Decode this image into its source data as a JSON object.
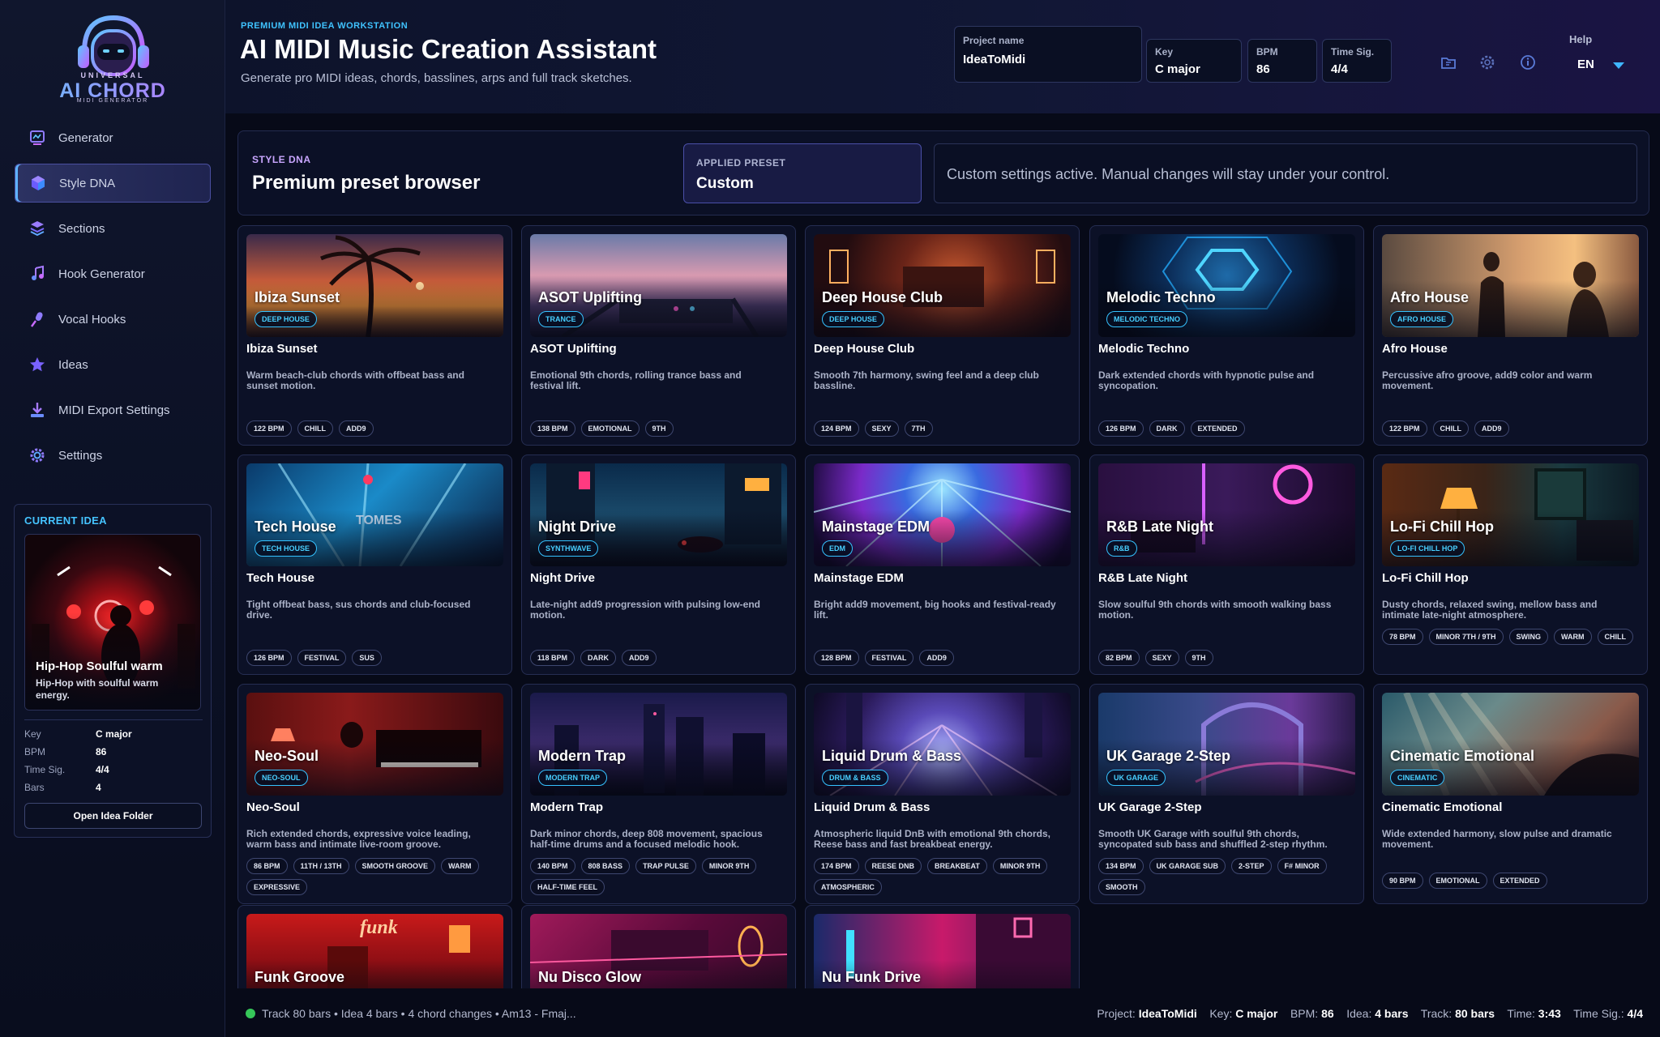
{
  "brand": {
    "line1": "UNIVERSAL",
    "line2": "AI CHORD",
    "line3": "MIDI GENERATOR"
  },
  "sidebar": {
    "items": [
      {
        "label": "Generator",
        "icon": "generator-icon",
        "active": false
      },
      {
        "label": "Style DNA",
        "icon": "style-dna-icon",
        "active": true
      },
      {
        "label": "Sections",
        "icon": "sections-icon",
        "active": false
      },
      {
        "label": "Hook Generator",
        "icon": "music-note-icon",
        "active": false
      },
      {
        "label": "Vocal Hooks",
        "icon": "microphone-icon",
        "active": false
      },
      {
        "label": "Ideas",
        "icon": "star-icon",
        "active": false
      },
      {
        "label": "MIDI Export Settings",
        "icon": "download-icon",
        "active": false
      },
      {
        "label": "Settings",
        "icon": "gear-icon",
        "active": false
      }
    ]
  },
  "current_idea": {
    "title": "CURRENT IDEA",
    "card_name": "Hip-Hop Soulful warm",
    "card_desc": "Hip-Hop with soulful warm energy.",
    "key_label": "Key",
    "key_value": "C major",
    "bpm_label": "BPM",
    "bpm_value": "86",
    "timesig_label": "Time Sig.",
    "timesig_value": "4/4",
    "bars_label": "Bars",
    "bars_value": "4",
    "open_button": "Open Idea Folder"
  },
  "header": {
    "eyebrow": "PREMIUM MIDI IDEA WORKSTATION",
    "title": "AI MIDI Music Creation Assistant",
    "subtitle": "Generate pro MIDI ideas, chords, basslines, arps and full track sketches.",
    "project_label": "Project name",
    "project_value": "IdeaToMidi",
    "key_label": "Key",
    "key_value": "C major",
    "bpm_label": "BPM",
    "bpm_value": "86",
    "timesig_label": "Time Sig.",
    "timesig_value": "4/4",
    "help": "Help",
    "language": "EN"
  },
  "style_dna": {
    "eyebrow": "STYLE DNA",
    "title": "Premium preset browser",
    "applied_label": "APPLIED PRESET",
    "applied_value": "Custom",
    "message": "Custom settings active. Manual changes will stay under your control."
  },
  "presets": [
    {
      "name": "Ibiza Sunset",
      "badge": "DEEP HOUSE",
      "desc": "Warm beach-club chords with offbeat bass and sunset motion.",
      "tags": [
        "122 BPM",
        "CHILL",
        "ADD9"
      ]
    },
    {
      "name": "ASOT Uplifting",
      "badge": "TRANCE",
      "desc": "Emotional 9th chords, rolling trance bass and festival lift.",
      "tags": [
        "138 BPM",
        "EMOTIONAL",
        "9TH"
      ]
    },
    {
      "name": "Deep House Club",
      "badge": "DEEP HOUSE",
      "desc": "Smooth 7th harmony, swing feel and a deep club bassline.",
      "tags": [
        "124 BPM",
        "SEXY",
        "7TH"
      ]
    },
    {
      "name": "Melodic Techno",
      "badge": "MELODIC TECHNO",
      "desc": "Dark extended chords with hypnotic pulse and syncopation.",
      "tags": [
        "126 BPM",
        "DARK",
        "EXTENDED"
      ]
    },
    {
      "name": "Afro House",
      "badge": "AFRO HOUSE",
      "desc": "Percussive afro groove, add9 color and warm movement.",
      "tags": [
        "122 BPM",
        "CHILL",
        "ADD9"
      ]
    },
    {
      "name": "Tech House",
      "badge": "TECH HOUSE",
      "desc": "Tight offbeat bass, sus chords and club-focused drive.",
      "tags": [
        "126 BPM",
        "FESTIVAL",
        "SUS"
      ]
    },
    {
      "name": "Night Drive",
      "badge": "SYNTHWAVE",
      "desc": "Late-night add9 progression with pulsing low-end motion.",
      "tags": [
        "118 BPM",
        "DARK",
        "ADD9"
      ]
    },
    {
      "name": "Mainstage EDM",
      "badge": "EDM",
      "desc": "Bright add9 movement, big hooks and festival-ready lift.",
      "tags": [
        "128 BPM",
        "FESTIVAL",
        "ADD9"
      ]
    },
    {
      "name": "R&B Late Night",
      "badge": "R&B",
      "desc": "Slow soulful 9th chords with smooth walking bass motion.",
      "tags": [
        "82 BPM",
        "SEXY",
        "9TH"
      ]
    },
    {
      "name": "Lo-Fi Chill Hop",
      "badge": "LO-FI CHILL HOP",
      "desc": "Dusty chords, relaxed swing, mellow bass and intimate late-night atmosphere.",
      "tags": [
        "78 BPM",
        "MINOR 7TH / 9TH",
        "SWING",
        "WARM",
        "CHILL"
      ]
    },
    {
      "name": "Neo-Soul",
      "badge": "NEO-SOUL",
      "desc": "Rich extended chords, expressive voice leading, warm bass and intimate live-room groove.",
      "tags": [
        "86 BPM",
        "11TH / 13TH",
        "SMOOTH GROOVE",
        "WARM",
        "EXPRESSIVE"
      ]
    },
    {
      "name": "Modern Trap",
      "badge": "MODERN TRAP",
      "desc": "Dark minor chords, deep 808 movement, spacious half-time drums and a focused melodic hook.",
      "tags": [
        "140 BPM",
        "808 BASS",
        "TRAP PULSE",
        "MINOR 9TH",
        "HALF-TIME FEEL"
      ]
    },
    {
      "name": "Liquid Drum & Bass",
      "badge": "DRUM & BASS",
      "desc": "Atmospheric liquid DnB with emotional 9th chords, Reese bass and fast breakbeat energy.",
      "tags": [
        "174 BPM",
        "REESE DNB",
        "BREAKBEAT",
        "MINOR 9TH",
        "ATMOSPHERIC"
      ]
    },
    {
      "name": "UK Garage 2-Step",
      "badge": "UK GARAGE",
      "desc": "Smooth UK Garage with soulful 9th chords, syncopated sub bass and shuffled 2-step rhythm.",
      "tags": [
        "134 BPM",
        "UK GARAGE SUB",
        "2-STEP",
        "F# MINOR",
        "SMOOTH"
      ]
    },
    {
      "name": "Cinematic Emotional",
      "badge": "CINEMATIC",
      "desc": "Wide extended harmony, slow pulse and dramatic movement.",
      "tags": [
        "90 BPM",
        "EMOTIONAL",
        "EXTENDED"
      ]
    },
    {
      "name": "Funk Groove",
      "thumb_sign": "funk"
    },
    {
      "name": "Nu Disco Glow"
    },
    {
      "name": "Nu Funk Drive"
    }
  ],
  "status": {
    "left": "Track 80 bars • Idea 4 bars • 4 chord changes • Am13 - Fmaj...",
    "project_label": "Project:",
    "project_value": "IdeaToMidi",
    "key_label": "Key:",
    "key_value": "C major",
    "bpm_label": "BPM:",
    "bpm_value": "86",
    "idea_label": "Idea:",
    "idea_value": "4 bars",
    "track_label": "Track:",
    "track_value": "80 bars",
    "time_label": "Time:",
    "time_value": "3:43",
    "timesig_label": "Time Sig.:",
    "timesig_value": "4/4"
  }
}
